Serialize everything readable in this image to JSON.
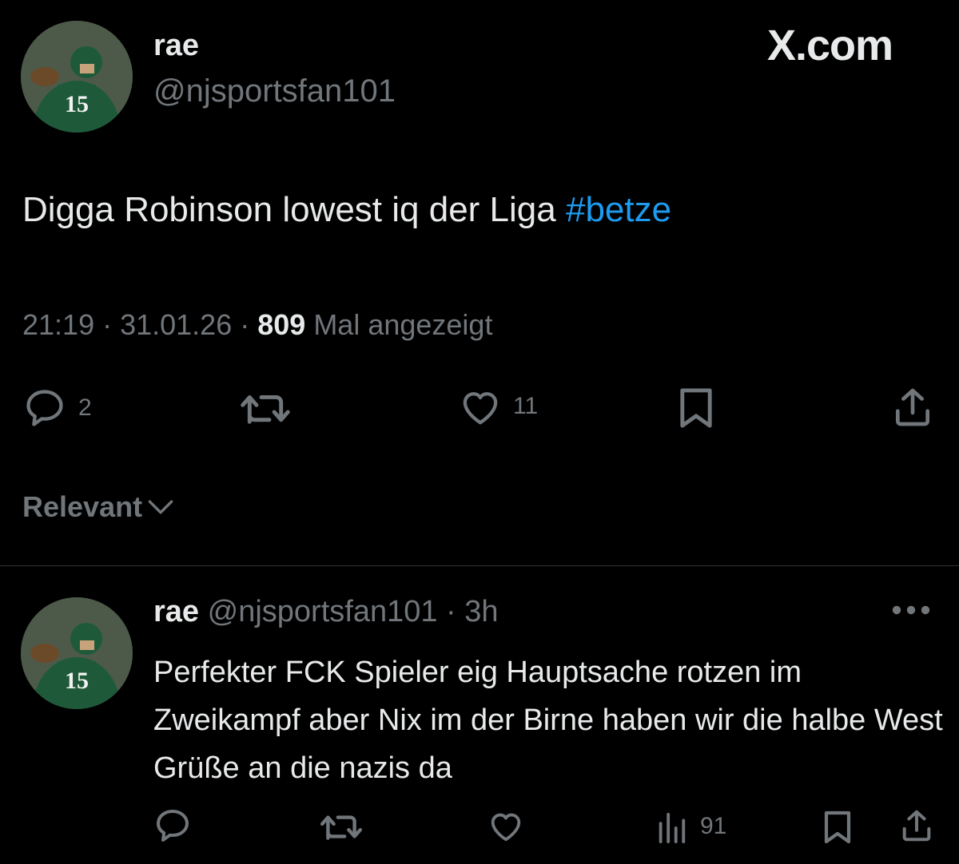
{
  "brand": {
    "label": "X.com"
  },
  "post": {
    "display_name": "rae",
    "handle": "@njsportsfan101",
    "text_main": "Digga Robinson lowest iq der Liga ",
    "hashtag": "#betze",
    "time": "21:19",
    "sep1": " · ",
    "date": "31.01.26",
    "sep2": " · ",
    "views": "809",
    "views_label": " Mal angezeigt",
    "actions": {
      "reply_count": "2",
      "like_count": "11"
    }
  },
  "sort": {
    "label": "Relevant"
  },
  "reply": {
    "display_name": "rae",
    "handle": "@njsportsfan101",
    "dot": " · ",
    "time": "3h",
    "text": "Perfekter FCK Spieler eig Hauptsache rotzen im Zweikampf aber Nix im der Birne haben wir die halbe West Grüße an die nazis da",
    "actions": {
      "views_count": "91"
    }
  },
  "avatar": {
    "jersey_number": "15"
  },
  "colors": {
    "background": "#000000",
    "text": "#e7e9ea",
    "muted": "#71767b",
    "link": "#1d9bf0",
    "divider": "#2f3336"
  },
  "icons": [
    "reply-icon",
    "repost-icon",
    "like-icon",
    "bookmark-icon",
    "share-icon",
    "views-icon",
    "more-icon",
    "chevron-down-icon"
  ]
}
